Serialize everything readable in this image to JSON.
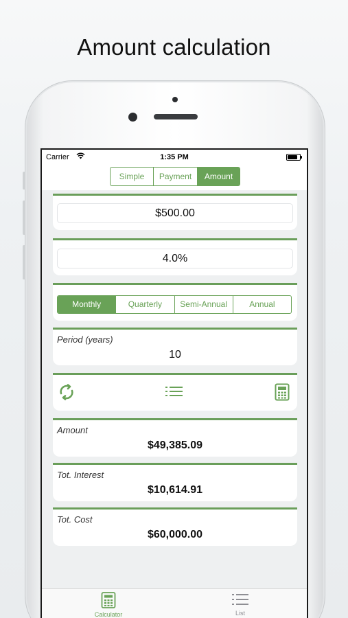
{
  "headline": "Amount calculation",
  "status": {
    "carrier": "Carrier",
    "time": "1:35 PM"
  },
  "modes": [
    {
      "label": "Simple",
      "active": false
    },
    {
      "label": "Payment",
      "active": false
    },
    {
      "label": "Amount",
      "active": true
    }
  ],
  "deposit": {
    "value": "$500.00"
  },
  "rate": {
    "value": "4.0%"
  },
  "frequency": [
    {
      "label": "Monthly",
      "active": true
    },
    {
      "label": "Quarterly",
      "active": false
    },
    {
      "label": "Semi-Annual",
      "active": false
    },
    {
      "label": "Annual",
      "active": false
    }
  ],
  "period": {
    "label": "Period (years)",
    "value": "10"
  },
  "actions": {
    "reset_icon": "refresh-icon",
    "list_icon": "list-icon",
    "calc_icon": "calculator-icon"
  },
  "results": {
    "amount": {
      "label": "Amount",
      "value": "$49,385.09"
    },
    "interest": {
      "label": "Tot. Interest",
      "value": "$10,614.91"
    },
    "cost": {
      "label": "Tot. Cost",
      "value": "$60,000.00"
    }
  },
  "tabs": [
    {
      "label": "Calculator",
      "icon": "calculator-icon",
      "active": true
    },
    {
      "label": "List",
      "icon": "list-icon",
      "active": false
    }
  ],
  "colors": {
    "accent": "#69a257",
    "card_border": "#6a9e5a",
    "background": "#eef0f1"
  }
}
